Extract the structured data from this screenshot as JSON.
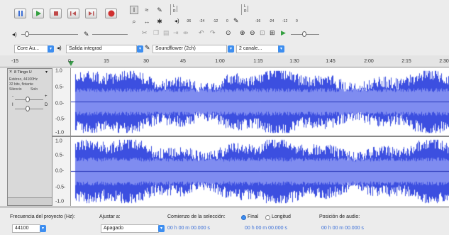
{
  "transport": {
    "pause_icon": "pause-icon",
    "play_icon": "play-icon",
    "stop_icon": "stop-icon",
    "skip_start_icon": "skip-start-icon",
    "skip_end_icon": "skip-end-icon",
    "record_icon": "record-icon",
    "colors": {
      "pause": "#3c6fd6",
      "play": "#33a040",
      "stop": "#c04848",
      "record": "#d03030"
    }
  },
  "meters": {
    "record_scale": [
      "-36",
      "-24",
      "-12",
      "0"
    ],
    "play_scale": [
      "-36",
      "-24",
      "-12",
      "0"
    ],
    "record_channels": [
      "L",
      "R"
    ],
    "play_channels": [
      "L",
      "R"
    ]
  },
  "devices": {
    "host": "Core Au...",
    "playback": "Salida integrad",
    "recording": "Soundflower (2ch)",
    "channels": "2 canale..."
  },
  "ruler": {
    "labels": [
      "-15",
      "0",
      "15",
      "30",
      "45",
      "1:00",
      "1:15",
      "1:30",
      "1:45",
      "2:00",
      "2:15",
      "2:30"
    ]
  },
  "track": {
    "name": "8 Tiingo U",
    "info_lines": [
      "Estéreo, 44100Hz",
      "32 bits, flotante"
    ],
    "mute_label": "Silencio",
    "solo_label": "Solo",
    "gain_minus": "-",
    "gain_plus": "+",
    "pan_left": "I",
    "pan_right": "D",
    "scale_ticks": [
      "1.0",
      "0.5-",
      "0.0-",
      "-0.5-",
      "-1.0"
    ],
    "scale_ticks_bottom": [
      "1.0",
      "0.5-",
      "0.0-",
      "-0.5-",
      "-1.0"
    ],
    "wave_color": "#3c4fe0",
    "wave_color_rms": "#7f8cf0"
  },
  "bottom": {
    "project_rate_label": "Frecuencia del proyecto (Hz):",
    "project_rate_value": "44100",
    "snap_label": "Ajustar a:",
    "snap_value": "Apagado",
    "selection_start_label": "Comienzo de la selección:",
    "end_option": "Final",
    "length_option": "Longitud",
    "audio_position_label": "Posición de audio:",
    "sel_start": "00 h 00 m 00.000 s",
    "sel_end": "00 h 00 m 00.000 s",
    "audio_pos": "00 h 00 m 00.000 s"
  }
}
